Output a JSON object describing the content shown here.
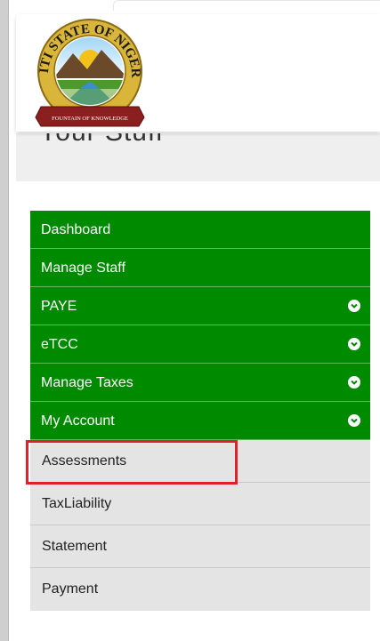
{
  "page": {
    "title": "Your Stuff"
  },
  "logo": {
    "top_text": "EKITI STATE OF NIGERIA",
    "ribbon_text": "FOUNTAIN OF KNOWLEDGE"
  },
  "menu": {
    "items": [
      {
        "label": "Dashboard",
        "has_dropdown": false
      },
      {
        "label": "Manage Staff",
        "has_dropdown": false
      },
      {
        "label": "PAYE",
        "has_dropdown": true
      },
      {
        "label": "eTCC",
        "has_dropdown": true
      },
      {
        "label": "Manage Taxes",
        "has_dropdown": true
      },
      {
        "label": "My Account",
        "has_dropdown": true
      }
    ],
    "sub_items": [
      {
        "label": "Assessments"
      },
      {
        "label": "TaxLiability"
      },
      {
        "label": "Statement"
      },
      {
        "label": "Payment"
      }
    ]
  },
  "colors": {
    "menu_green": "#008a00",
    "sub_bg": "#e4e4e4",
    "highlight": "#e0202b"
  },
  "icons": {
    "dropdown": "chevron-circle-down-icon"
  }
}
